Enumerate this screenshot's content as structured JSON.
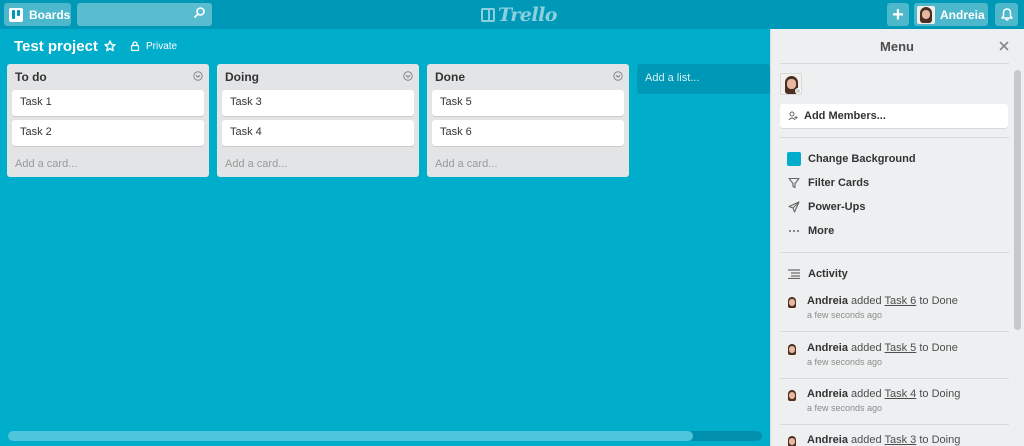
{
  "header": {
    "boards_label": "Boards",
    "search_placeholder": "",
    "logo_text": "Trello",
    "user_name": "Andreia"
  },
  "board": {
    "title": "Test project",
    "privacy": "Private",
    "background_color": "#00AECC"
  },
  "lists": [
    {
      "title": "To do",
      "cards": [
        "Task 1",
        "Task 2"
      ],
      "add_card": "Add a card..."
    },
    {
      "title": "Doing",
      "cards": [
        "Task 3",
        "Task 4"
      ],
      "add_card": "Add a card..."
    },
    {
      "title": "Done",
      "cards": [
        "Task 5",
        "Task 6"
      ],
      "add_card": "Add a card..."
    }
  ],
  "add_list_label": "Add a list...",
  "menu": {
    "title": "Menu",
    "add_members": "Add Members...",
    "items": {
      "change_background": "Change Background",
      "filter_cards": "Filter Cards",
      "power_ups": "Power-Ups",
      "more": "More"
    },
    "activity_label": "Activity",
    "activity": [
      {
        "user": "Andreia",
        "verb": "added",
        "card": "Task 6",
        "prep": "to",
        "list": "Done",
        "time": "a few seconds ago"
      },
      {
        "user": "Andreia",
        "verb": "added",
        "card": "Task 5",
        "prep": "to",
        "list": "Done",
        "time": "a few seconds ago"
      },
      {
        "user": "Andreia",
        "verb": "added",
        "card": "Task 4",
        "prep": "to",
        "list": "Doing",
        "time": "a few seconds ago"
      },
      {
        "user": "Andreia",
        "verb": "added",
        "card": "Task 3",
        "prep": "to",
        "list": "Doing",
        "time": ""
      }
    ]
  }
}
